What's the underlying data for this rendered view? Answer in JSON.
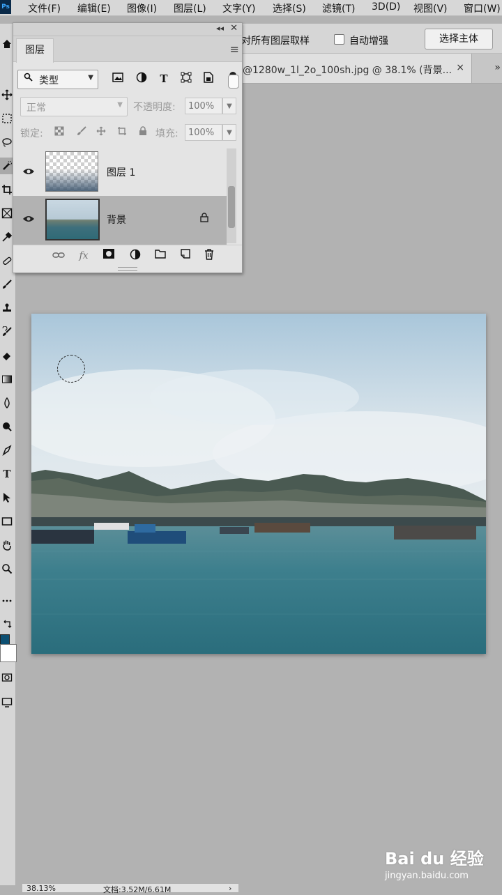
{
  "app": {
    "logo_text": "Ps"
  },
  "menu": [
    "文件(F)",
    "编辑(E)",
    "图像(I)",
    "图层(L)",
    "文字(Y)",
    "选择(S)",
    "滤镜(T)",
    "3D(D)",
    "视图(V)",
    "窗口(W)"
  ],
  "options_bar": {
    "sample_all_layers_label": "对所有图层取样",
    "auto_enhance_label": "自动增强",
    "select_subject_label": "选择主体"
  },
  "document_tab": {
    "title": "@1280w_1l_2o_100sh.jpg @ 38.1% (背景...",
    "close": "×",
    "overflow": "»"
  },
  "layers_panel": {
    "tab_label": "图层",
    "filter_kind": "类型",
    "filter_icons": [
      "image-filter-icon",
      "adjustment-filter-icon",
      "type-filter-icon",
      "shape-filter-icon",
      "smart-object-filter-icon"
    ],
    "blend_mode": "正常",
    "opacity_label": "不透明度:",
    "opacity_value": "100%",
    "lock_label": "锁定:",
    "fill_label": "填充:",
    "fill_value": "100%",
    "layers": [
      {
        "name": "图层 1",
        "visible": true,
        "selected": false,
        "locked": false
      },
      {
        "name": "背景",
        "visible": true,
        "selected": true,
        "locked": true
      }
    ],
    "footer_icons": [
      "link-layers-icon",
      "fx-icon",
      "add-mask-icon",
      "new-adjustment-icon",
      "new-group-icon",
      "new-layer-icon",
      "delete-icon"
    ],
    "footer_fx_text": "fx"
  },
  "status": {
    "zoom": "38.13%",
    "doc_info": "文档:3.52M/6.61M",
    "arrow": "›"
  },
  "colors": {
    "foreground": "#0d4f72",
    "background": "#ffffff"
  },
  "watermark": {
    "main": "Bai du 经验",
    "sub": "jingyan.baidu.com"
  }
}
